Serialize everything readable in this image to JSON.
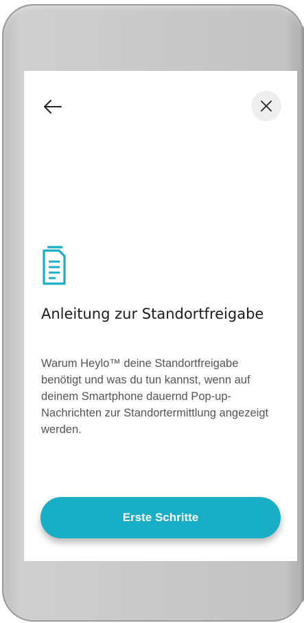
{
  "header": {
    "back_icon": "arrow-left-icon",
    "close_icon": "close-icon"
  },
  "content": {
    "icon": "document-icon",
    "title": "Anleitung zur Standortfreigabe",
    "description": "Warum Heylo™ deine Standortfreigabe benötigt und was du tun kannst, wenn auf deinem Smartphone dauernd Pop-up-Nachrichten zur Standortermittlung angezeigt werden."
  },
  "footer": {
    "cta_label": "Erste Schritte"
  },
  "colors": {
    "accent": "#17aec6",
    "title": "#1a1a1a",
    "body_text": "#555555",
    "close_bg": "#eeeeee"
  }
}
